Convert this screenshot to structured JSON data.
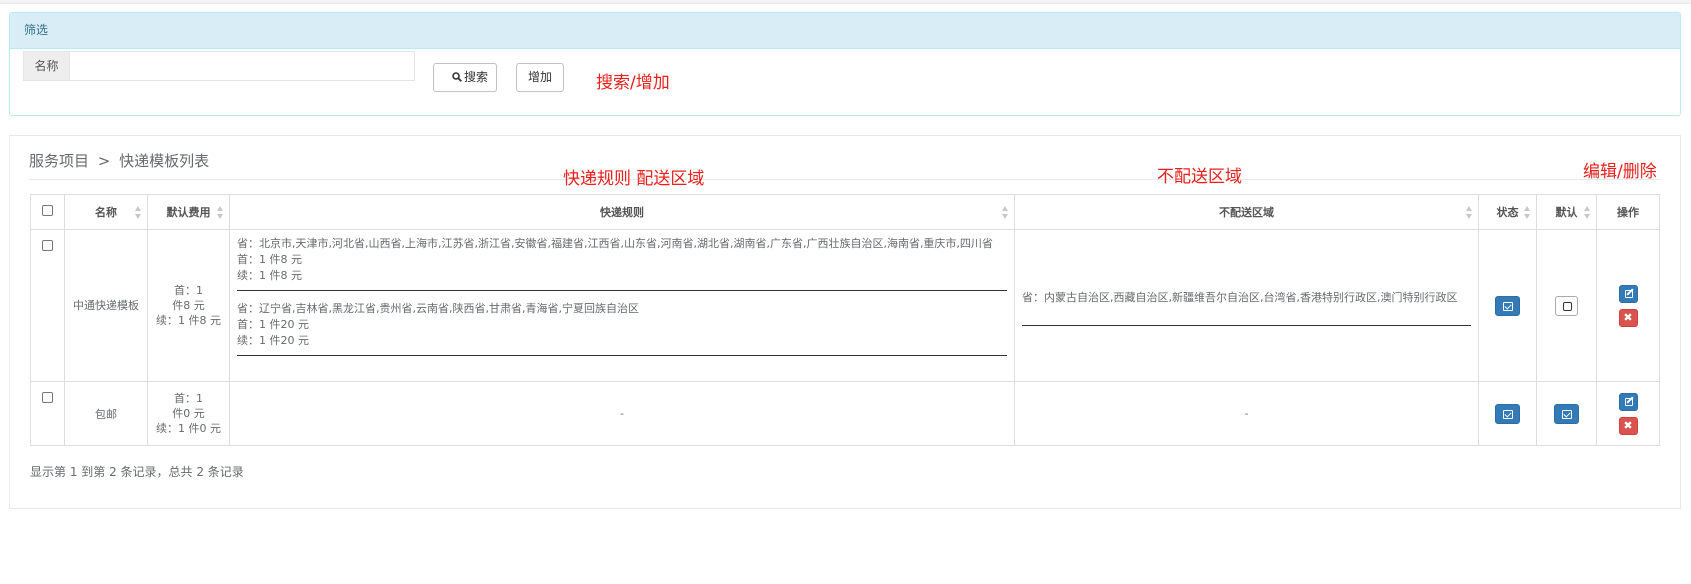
{
  "filter": {
    "panel_title": "筛选",
    "name_label": "名称",
    "name_value": "",
    "search_label": "搜索",
    "add_label": "增加"
  },
  "annotations": {
    "search_add": "搜索/增加",
    "rules_area": "快递规则 配送区域",
    "no_area": "不配送区域",
    "edit_delete": "编辑/删除"
  },
  "breadcrumb": {
    "parent": "服务项目",
    "separator": ">",
    "current": "快递模板列表"
  },
  "table": {
    "headers": {
      "name": "名称",
      "default_fee": "默认费用",
      "rules": "快递规则",
      "no_delivery": "不配送区域",
      "status": "状态",
      "is_default": "默认",
      "actions": "操作"
    },
    "rows": [
      {
        "name": "中通快递模板",
        "fee_first": "首：1 件8 元",
        "fee_next": "续：1 件8 元",
        "rules": [
          {
            "provinces": "省：北京市,天津市,河北省,山西省,上海市,江苏省,浙江省,安徽省,福建省,江西省,山东省,河南省,湖北省,湖南省,广东省,广西壮族自治区,海南省,重庆市,四川省",
            "first": "首：1 件8 元",
            "next": "续：1 件8 元"
          },
          {
            "provinces": "省：辽宁省,吉林省,黑龙江省,贵州省,云南省,陕西省,甘肃省,青海省,宁夏回族自治区",
            "first": "首：1 件20 元",
            "next": "续：1 件20 元"
          }
        ],
        "no_delivery": "省：内蒙古自治区,西藏自治区,新疆维吾尔自治区,台湾省,香港特别行政区,澳门特别行政区",
        "status_on": true,
        "default_on": false
      },
      {
        "name": "包邮",
        "fee_first": "首：1 件0 元",
        "fee_next": "续：1 件0 元",
        "rules_text": "-",
        "no_delivery": "-",
        "status_on": true,
        "default_on": true
      }
    ]
  },
  "pagination": {
    "summary": "显示第 1 到第 2 条记录，总共 2 条记录"
  },
  "colors": {
    "primary": "#337ab7",
    "danger": "#d9534f",
    "info_bg": "#d9edf7",
    "annotation": "#e8211e"
  }
}
